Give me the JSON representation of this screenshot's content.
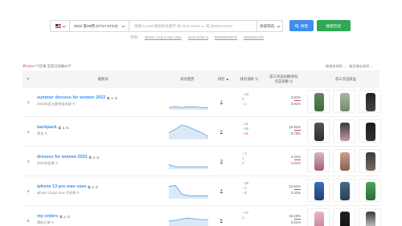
{
  "search": {
    "market": "US",
    "week_range": "2022 第29周 (07/17-07/23)",
    "keyword_placeholder": "请输入ASIN或搜索关键字 如:dock series a, 或 B0B5UHAZN",
    "advanced_label": "高级筛选",
    "search_button": "搜索",
    "history_button": "搜索历史"
  },
  "examples": {
    "prefix": "示例:",
    "items": [
      "iphone 13 pro max case",
      "dock series a",
      "B08G8MSR7K",
      "B08GB4AZN"
    ]
  },
  "summary": {
    "prefix": "共",
    "count": "1000+",
    "middle": "个结果,当前已加载",
    "loaded": "20",
    "suffix": "个"
  },
  "sort_links": [
    "按排名排序→",
    "按月增长排序→"
  ],
  "table": {
    "headers": {
      "index": "#",
      "keyword": "搜索词",
      "trend": "排名趋势",
      "rank": "排名 ▲",
      "rank_change": "排名涨跌 ⇅",
      "ratio": "前三点击份额/转化\n点击份额 ⇅",
      "products": "前三点击商品"
    },
    "rows": [
      {
        "index": "1",
        "keyword": "summer dresses for women 2022",
        "translation": "2022年女士夏季连衣裙",
        "rank": "1",
        "change_up": "↑ 13",
        "change_a": "2",
        "change_b": "↓ 1",
        "click_share": "3.81%",
        "conversion": "0.81%",
        "trend": [
          0.05,
          0.1,
          0.05,
          0.1,
          0.08,
          0.05,
          0.04
        ],
        "color": "#5b9bd5",
        "products": [
          "dress-green",
          "dress-floral",
          "dress-black"
        ]
      },
      {
        "index": "2",
        "keyword": "backpack",
        "translation": "背包",
        "rank": "2",
        "change_up": "↑ 11",
        "change_a": "↑ 40",
        "change_b": "↑ 31",
        "click_share": "15.92%",
        "conversion": "0.75%",
        "trend": [
          0.35,
          0.6,
          0.9,
          0.75,
          0.55,
          0.35,
          0.1
        ],
        "color": "#5b9bd5",
        "products": [
          "backpack-gray",
          "backpack-pink",
          "backpack-black"
        ]
      },
      {
        "index": "3",
        "keyword": "dresses for women 2022",
        "translation": "2022年女装",
        "rank": "3",
        "change_up": "↑ 1",
        "change_a": "1",
        "change_b": "1",
        "click_share": "4.41%",
        "conversion": "1.01%",
        "trend": [
          0.2,
          0.05,
          0.05,
          0.05,
          0.05,
          0.05,
          0.05
        ],
        "color": "#5b9bd5",
        "products": [
          "dress-floral-2",
          "dress-blue",
          "dress-tan"
        ]
      },
      {
        "index": "4",
        "keyword": "iphone 13 pro max case",
        "translation": "iphone 13 pro max 手机壳",
        "rank": "4",
        "change_up": "↑ 26",
        "change_a": "↑ 2",
        "change_b": "↓ 5",
        "click_share": "12.61%",
        "conversion": "0.11%",
        "trend": [
          0.75,
          0.8,
          0.2,
          0.1,
          0.1,
          0.1,
          0.1
        ],
        "color": "#5b9bd5",
        "products": [
          "case-blue",
          "case-navy",
          "case-green"
        ]
      },
      {
        "index": "5",
        "keyword": "my orders",
        "translation": "我的订单",
        "rank": "5",
        "change_up": "↑ 27",
        "change_a": "1",
        "change_b": "",
        "click_share": "10.23%",
        "conversion": "0.21%",
        "trend": [
          0.4,
          0.45,
          0.55,
          0.6,
          0.55,
          0.5,
          0.5
        ],
        "color": "#5b9bd5",
        "products": [
          "bra-pink",
          "bra-black",
          "jar-cream"
        ]
      }
    ]
  }
}
